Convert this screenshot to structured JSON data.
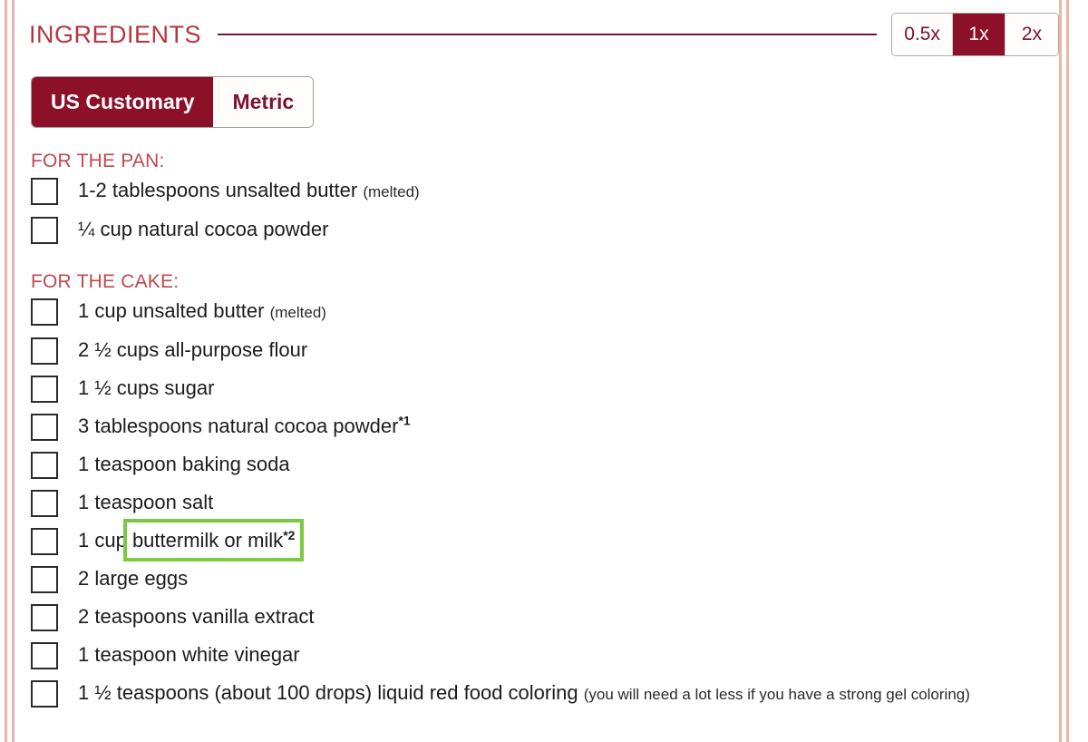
{
  "header": {
    "title": "INGREDIENTS",
    "divider_color": "#7d1232"
  },
  "scale": {
    "options": [
      {
        "label": "0.5x",
        "active": false
      },
      {
        "label": "1x",
        "active": true
      },
      {
        "label": "2x",
        "active": false
      }
    ],
    "selected": "1x",
    "active_color": "#8b1028"
  },
  "units": {
    "options": [
      {
        "label": "US Customary",
        "active": true
      },
      {
        "label": "Metric",
        "active": false
      }
    ],
    "selected": "US Customary"
  },
  "groups": [
    {
      "heading": "FOR THE PAN:",
      "items": [
        {
          "amount": "1-2 tablespoons unsalted butter",
          "note": "(melted)",
          "sup": ""
        },
        {
          "amount": "¼ cup natural cocoa powder",
          "note": "",
          "sup": ""
        }
      ]
    },
    {
      "heading": "FOR THE CAKE:",
      "items": [
        {
          "amount": "1 cup unsalted butter",
          "note": "(melted)",
          "sup": ""
        },
        {
          "amount": "2 ½ cups all-purpose flour",
          "note": "",
          "sup": ""
        },
        {
          "amount": "1 ½ cups sugar",
          "note": "",
          "sup": ""
        },
        {
          "amount": "3 tablespoons natural cocoa powder",
          "note": "",
          "sup": "*1"
        },
        {
          "amount": "1 teaspoon baking soda",
          "note": "",
          "sup": ""
        },
        {
          "amount": "1 teaspoon salt",
          "note": "",
          "sup": ""
        },
        {
          "amount": "1 cup buttermilk or milk",
          "note": "",
          "sup": "*2",
          "highlighted": true,
          "prefix": "1 cup ",
          "highlight_text": "buttermilk or milk"
        },
        {
          "amount": "2 large eggs",
          "note": "",
          "sup": ""
        },
        {
          "amount": "2 teaspoons vanilla extract",
          "note": "",
          "sup": ""
        },
        {
          "amount": "1 teaspoon white vinegar",
          "note": "",
          "sup": ""
        },
        {
          "amount": "1 ½ teaspoons (about 100 drops) liquid red food coloring",
          "note": "(you will need a lot less if you have a strong gel coloring)",
          "sup": ""
        }
      ]
    }
  ],
  "highlight": {
    "color": "#7ac943"
  },
  "checkbox_glyph": "empty-checkbox"
}
